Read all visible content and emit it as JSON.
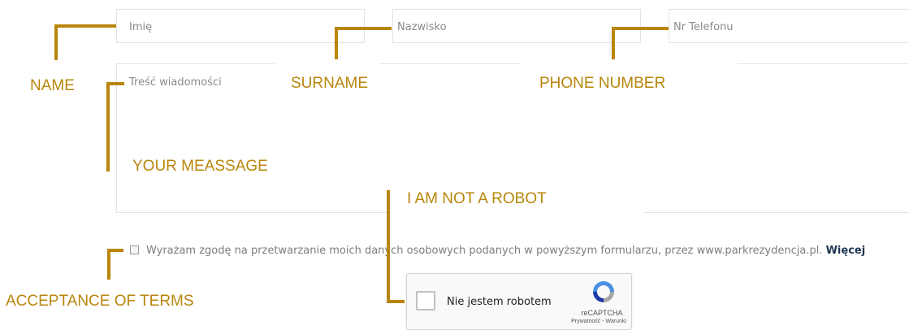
{
  "form": {
    "name_placeholder": "Imię",
    "surname_placeholder": "Nazwisko",
    "phone_placeholder": "Nr Telefonu",
    "message_placeholder": "Treść wiadomości",
    "consent_text": "Wyrażam zgodę na przetwarzanie moich danych osobowych podanych w powyższym formularzu, przez www.parkrezydencja.pl. ",
    "consent_link": "Więcej"
  },
  "captcha": {
    "label": "Nie jestem robotem",
    "brand": "reCAPTCHA",
    "links": "Prywatność - Warunki",
    "icon": "recaptcha-logo-icon"
  },
  "annotations": {
    "name": "NAME",
    "surname": "SURNAME",
    "phone": "PHONE NUMBER",
    "message": "YOUR MEASSAGE",
    "robot": "I AM NOT A ROBOT",
    "terms": "ACCEPTANCE OF TERMS"
  },
  "colors": {
    "annotation": "#b8860b",
    "link": "#1f3552",
    "placeholder": "#8a8a8a"
  }
}
